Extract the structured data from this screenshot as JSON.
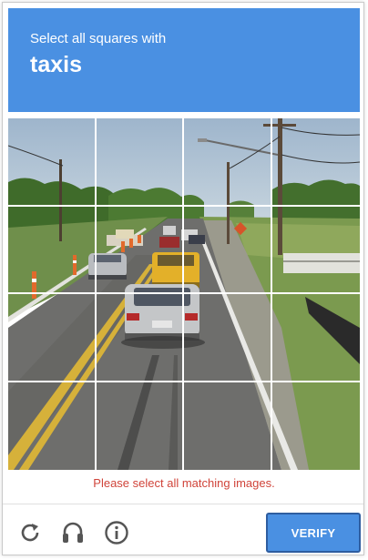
{
  "challenge": {
    "instruction": "Select all squares with",
    "target": "taxis"
  },
  "grid": {
    "rows": 4,
    "cols": 4
  },
  "error_message": "Please select all matching images.",
  "footer": {
    "icons": [
      "reload-icon",
      "audio-icon",
      "info-icon"
    ],
    "verify_label": "VERIFY"
  },
  "colors": {
    "header": "#4a90e2",
    "button": "#4a90e2",
    "error": "#d0443a"
  }
}
